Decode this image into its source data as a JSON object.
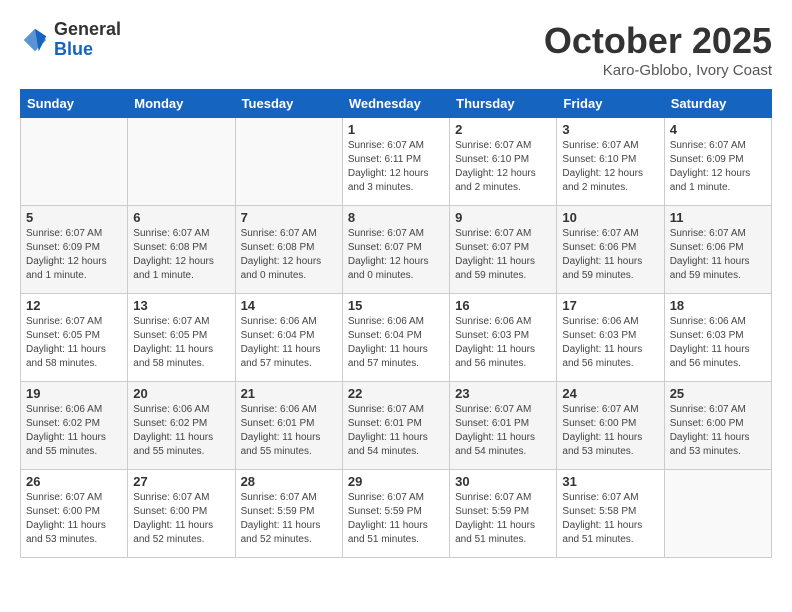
{
  "logo": {
    "general": "General",
    "blue": "Blue"
  },
  "title": "October 2025",
  "subtitle": "Karo-Gblobo, Ivory Coast",
  "headers": [
    "Sunday",
    "Monday",
    "Tuesday",
    "Wednesday",
    "Thursday",
    "Friday",
    "Saturday"
  ],
  "weeks": [
    [
      {
        "day": "",
        "info": ""
      },
      {
        "day": "",
        "info": ""
      },
      {
        "day": "",
        "info": ""
      },
      {
        "day": "1",
        "info": "Sunrise: 6:07 AM\nSunset: 6:11 PM\nDaylight: 12 hours\nand 3 minutes."
      },
      {
        "day": "2",
        "info": "Sunrise: 6:07 AM\nSunset: 6:10 PM\nDaylight: 12 hours\nand 2 minutes."
      },
      {
        "day": "3",
        "info": "Sunrise: 6:07 AM\nSunset: 6:10 PM\nDaylight: 12 hours\nand 2 minutes."
      },
      {
        "day": "4",
        "info": "Sunrise: 6:07 AM\nSunset: 6:09 PM\nDaylight: 12 hours\nand 1 minute."
      }
    ],
    [
      {
        "day": "5",
        "info": "Sunrise: 6:07 AM\nSunset: 6:09 PM\nDaylight: 12 hours\nand 1 minute."
      },
      {
        "day": "6",
        "info": "Sunrise: 6:07 AM\nSunset: 6:08 PM\nDaylight: 12 hours\nand 1 minute."
      },
      {
        "day": "7",
        "info": "Sunrise: 6:07 AM\nSunset: 6:08 PM\nDaylight: 12 hours\nand 0 minutes."
      },
      {
        "day": "8",
        "info": "Sunrise: 6:07 AM\nSunset: 6:07 PM\nDaylight: 12 hours\nand 0 minutes."
      },
      {
        "day": "9",
        "info": "Sunrise: 6:07 AM\nSunset: 6:07 PM\nDaylight: 11 hours\nand 59 minutes."
      },
      {
        "day": "10",
        "info": "Sunrise: 6:07 AM\nSunset: 6:06 PM\nDaylight: 11 hours\nand 59 minutes."
      },
      {
        "day": "11",
        "info": "Sunrise: 6:07 AM\nSunset: 6:06 PM\nDaylight: 11 hours\nand 59 minutes."
      }
    ],
    [
      {
        "day": "12",
        "info": "Sunrise: 6:07 AM\nSunset: 6:05 PM\nDaylight: 11 hours\nand 58 minutes."
      },
      {
        "day": "13",
        "info": "Sunrise: 6:07 AM\nSunset: 6:05 PM\nDaylight: 11 hours\nand 58 minutes."
      },
      {
        "day": "14",
        "info": "Sunrise: 6:06 AM\nSunset: 6:04 PM\nDaylight: 11 hours\nand 57 minutes."
      },
      {
        "day": "15",
        "info": "Sunrise: 6:06 AM\nSunset: 6:04 PM\nDaylight: 11 hours\nand 57 minutes."
      },
      {
        "day": "16",
        "info": "Sunrise: 6:06 AM\nSunset: 6:03 PM\nDaylight: 11 hours\nand 56 minutes."
      },
      {
        "day": "17",
        "info": "Sunrise: 6:06 AM\nSunset: 6:03 PM\nDaylight: 11 hours\nand 56 minutes."
      },
      {
        "day": "18",
        "info": "Sunrise: 6:06 AM\nSunset: 6:03 PM\nDaylight: 11 hours\nand 56 minutes."
      }
    ],
    [
      {
        "day": "19",
        "info": "Sunrise: 6:06 AM\nSunset: 6:02 PM\nDaylight: 11 hours\nand 55 minutes."
      },
      {
        "day": "20",
        "info": "Sunrise: 6:06 AM\nSunset: 6:02 PM\nDaylight: 11 hours\nand 55 minutes."
      },
      {
        "day": "21",
        "info": "Sunrise: 6:06 AM\nSunset: 6:01 PM\nDaylight: 11 hours\nand 55 minutes."
      },
      {
        "day": "22",
        "info": "Sunrise: 6:07 AM\nSunset: 6:01 PM\nDaylight: 11 hours\nand 54 minutes."
      },
      {
        "day": "23",
        "info": "Sunrise: 6:07 AM\nSunset: 6:01 PM\nDaylight: 11 hours\nand 54 minutes."
      },
      {
        "day": "24",
        "info": "Sunrise: 6:07 AM\nSunset: 6:00 PM\nDaylight: 11 hours\nand 53 minutes."
      },
      {
        "day": "25",
        "info": "Sunrise: 6:07 AM\nSunset: 6:00 PM\nDaylight: 11 hours\nand 53 minutes."
      }
    ],
    [
      {
        "day": "26",
        "info": "Sunrise: 6:07 AM\nSunset: 6:00 PM\nDaylight: 11 hours\nand 53 minutes."
      },
      {
        "day": "27",
        "info": "Sunrise: 6:07 AM\nSunset: 6:00 PM\nDaylight: 11 hours\nand 52 minutes."
      },
      {
        "day": "28",
        "info": "Sunrise: 6:07 AM\nSunset: 5:59 PM\nDaylight: 11 hours\nand 52 minutes."
      },
      {
        "day": "29",
        "info": "Sunrise: 6:07 AM\nSunset: 5:59 PM\nDaylight: 11 hours\nand 51 minutes."
      },
      {
        "day": "30",
        "info": "Sunrise: 6:07 AM\nSunset: 5:59 PM\nDaylight: 11 hours\nand 51 minutes."
      },
      {
        "day": "31",
        "info": "Sunrise: 6:07 AM\nSunset: 5:58 PM\nDaylight: 11 hours\nand 51 minutes."
      },
      {
        "day": "",
        "info": ""
      }
    ]
  ]
}
